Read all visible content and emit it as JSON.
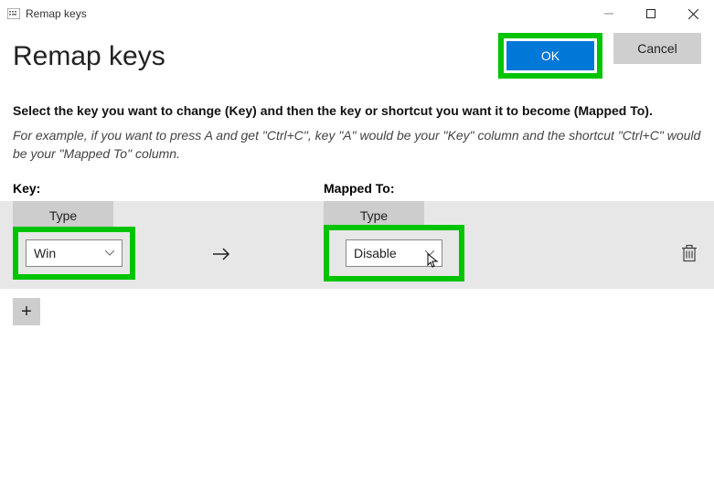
{
  "window": {
    "title": "Remap keys"
  },
  "header": {
    "main_title": "Remap keys",
    "ok_label": "OK",
    "cancel_label": "Cancel"
  },
  "instructions": {
    "bold": "Select the key you want to change (Key) and then the key or shortcut you want it to become (Mapped To).",
    "italic": "For example, if you want to press A and get \"Ctrl+C\", key \"A\" would be your \"Key\" column and the shortcut \"Ctrl+C\" would be your \"Mapped To\" column."
  },
  "columns": {
    "key_label": "Key:",
    "mapped_label": "Mapped To:",
    "type_label_key": "Type",
    "type_label_mapped": "Type"
  },
  "mapping": {
    "key_value": "Win",
    "mapped_value": "Disable",
    "add_label": "+"
  }
}
